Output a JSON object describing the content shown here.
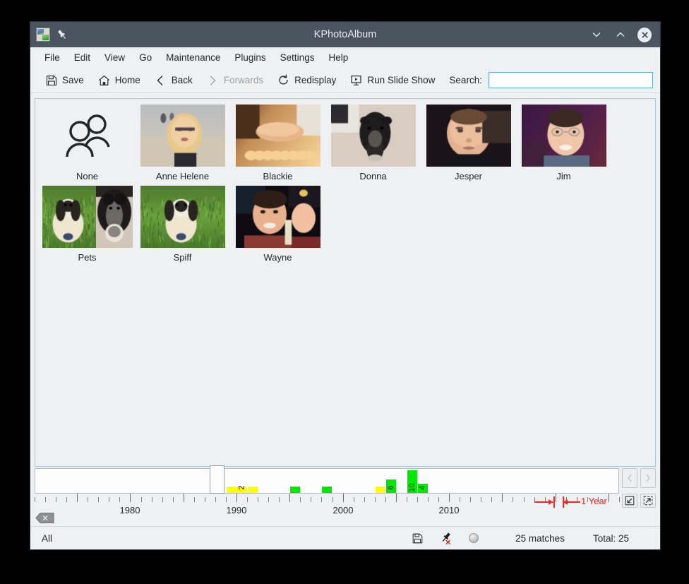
{
  "window": {
    "title": "KPhotoAlbum",
    "app_icon": "kphotoalbum-icon",
    "pin_icon": "pin-icon",
    "minimize_label": "⌄",
    "maximize_label": "⌃",
    "close_label": "✕"
  },
  "menubar": {
    "items": [
      {
        "label": "File"
      },
      {
        "label": "Edit"
      },
      {
        "label": "View"
      },
      {
        "label": "Go"
      },
      {
        "label": "Maintenance"
      },
      {
        "label": "Plugins"
      },
      {
        "label": "Settings"
      },
      {
        "label": "Help"
      }
    ]
  },
  "toolbar": {
    "buttons": [
      {
        "label": "Save",
        "icon": "floppy-disk-icon",
        "disabled": false
      },
      {
        "label": "Home",
        "icon": "home-icon",
        "disabled": false
      },
      {
        "label": "Back",
        "icon": "chevron-left-icon",
        "disabled": false
      },
      {
        "label": "Forwards",
        "icon": "chevron-right-icon",
        "disabled": true
      },
      {
        "label": "Redisplay",
        "icon": "refresh-icon",
        "disabled": false
      },
      {
        "label": "Run Slide Show",
        "icon": "slideshow-icon",
        "disabled": false
      }
    ],
    "search_label": "Search:",
    "search_value": "",
    "search_placeholder": "",
    "search_focused": true
  },
  "grid": {
    "items": [
      {
        "label": "None",
        "icon": "people-placeholder-icon",
        "thumb": "none"
      },
      {
        "label": "Anne Helene",
        "thumb": "anne-helene"
      },
      {
        "label": "Blackie",
        "thumb": "blackie"
      },
      {
        "label": "Donna",
        "thumb": "donna"
      },
      {
        "label": "Jesper",
        "thumb": "jesper"
      },
      {
        "label": "Jim",
        "thumb": "jim"
      },
      {
        "label": "Pets",
        "thumb": "pets"
      },
      {
        "label": "Spiff",
        "thumb": "spiff"
      },
      {
        "label": "Wayne",
        "thumb": "wayne"
      }
    ]
  },
  "timeline": {
    "year_labels": [
      {
        "year": 1980,
        "label": "1980"
      },
      {
        "year": 1990,
        "label": "1990"
      },
      {
        "year": 2000,
        "label": "2000"
      },
      {
        "year": 2010,
        "label": "2010"
      }
    ],
    "axis_start_year": 1971,
    "axis_end_year": 2026,
    "unit_label": "1 Year",
    "cursor_year": 1988,
    "bars": [
      {
        "year": 1989,
        "count": 1,
        "color": "#ffff00",
        "label": ""
      },
      {
        "year": 1990,
        "count": 2,
        "color": "#ffff00",
        "label": "2"
      },
      {
        "year": 1991,
        "count": 1,
        "color": "#ffff00",
        "label": ""
      },
      {
        "year": 1995,
        "count": 1,
        "color": "#00e800",
        "label": ""
      },
      {
        "year": 1998,
        "count": 1,
        "color": "#00e800",
        "label": ""
      },
      {
        "year": 2003,
        "count": 1,
        "color": "#ffff00",
        "label": ""
      },
      {
        "year": 2004,
        "count": 6,
        "color": "#00e800",
        "label": "6"
      },
      {
        "year": 2006,
        "count": 10,
        "color": "#00e800",
        "label": "10"
      },
      {
        "year": 2007,
        "count": 4,
        "color": "#00e800",
        "label": "4"
      }
    ],
    "nav_prev_icon": "chevron-left-icon",
    "nav_next_icon": "chevron-right-icon",
    "nav_prev_disabled": true,
    "nav_next_disabled": true,
    "zoom_out_icon": "zoom-out-icon",
    "zoom_in_icon": "zoom-in-icon",
    "clear_tag_icon": "clear-tag-icon"
  },
  "statusbar": {
    "scope_label": "All",
    "save_icon": "floppy-disk-icon",
    "disconnect_icon": "pin-disconnected-icon",
    "indicator_icon": "sphere-indicator",
    "matches_label": "25 matches",
    "total_label": "Total: 25"
  },
  "colors": {
    "titlebar": "#4b5560",
    "chrome": "#eff0f1",
    "bar_green": "#00e800",
    "bar_yellow": "#ffff00",
    "accent_red": "#ff2020",
    "focus_blue": "#5aaee0"
  }
}
